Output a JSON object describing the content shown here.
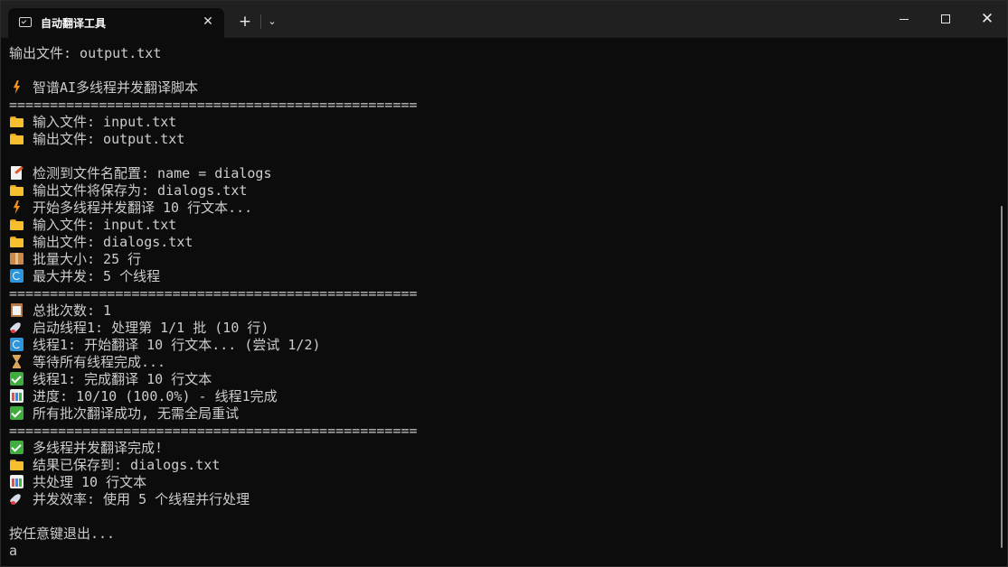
{
  "window": {
    "tab_title": "自动翻译工具",
    "tab_close": "✕",
    "new_tab": "+",
    "dropdown": "⌄",
    "close": "✕"
  },
  "terminal": {
    "lines": [
      "输出文件: output.txt",
      "智谱AI多线程并发翻译脚本",
      "==================================================",
      "输入文件: input.txt",
      "输出文件: output.txt",
      "检测到文件名配置: name = dialogs",
      "输出文件将保存为: dialogs.txt",
      "开始多线程并发翻译 10 行文本...",
      "输入文件: input.txt",
      "输出文件: dialogs.txt",
      "批量大小: 25 行",
      "最大并发: 5 个线程",
      "==================================================",
      "总批次数: 1",
      "启动线程1: 处理第 1/1 批 (10 行)",
      "线程1: 开始翻译 10 行文本... (尝试 1/2)",
      "等待所有线程完成...",
      "线程1: 完成翻译 10 行文本",
      "进度: 10/10 (100.0%) - 线程1完成",
      "所有批次翻译成功, 无需全局重试",
      "==================================================",
      "多线程并发翻译完成!",
      "结果已保存到: dialogs.txt",
      "共处理 10 行文本",
      "并发效率: 使用 5 个线程并行处理",
      "按任意键退出...",
      "a"
    ],
    "icons": {
      "bolt": "high-voltage",
      "folder": "folder",
      "memo": "memo",
      "package": "package",
      "arrows": "counterclockwise-arrows",
      "clipboard": "clipboard",
      "rocket": "rocket",
      "hourglass": "hourglass",
      "check": "check-mark",
      "chart": "bar-chart"
    }
  }
}
